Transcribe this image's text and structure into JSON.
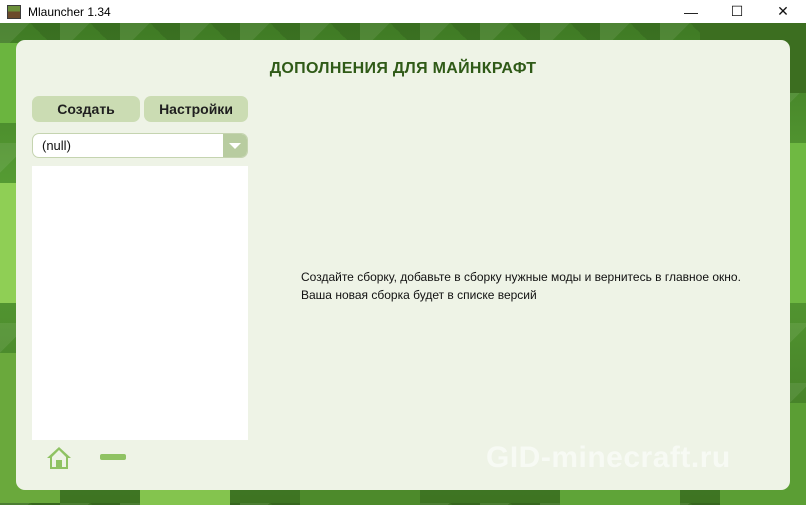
{
  "window": {
    "title": "Mlauncher 1.34",
    "controls": {
      "minimize": "—",
      "maximize": "☐",
      "close": "✕"
    }
  },
  "heading": "ДОПОЛНЕНИЯ ДЛЯ МАЙНКРАФТ",
  "buttons": {
    "create": "Создать",
    "settings": "Настройки"
  },
  "version_select": {
    "value": "(null)"
  },
  "message": {
    "line1": "Создайте сборку, добавьте в сборку нужные моды и вернитесь в главное окно.",
    "line2": "Ваша новая сборка будет в списке версий"
  },
  "watermark": "GID-minecraft.ru",
  "icons": {
    "home": "home-icon",
    "remove": "minus-icon",
    "dropdown": "chevron-down-icon"
  },
  "colors": {
    "panel": "#eef3e6",
    "heading": "#2f5a17",
    "button": "#cbdcb3",
    "accent": "#8fc263"
  }
}
